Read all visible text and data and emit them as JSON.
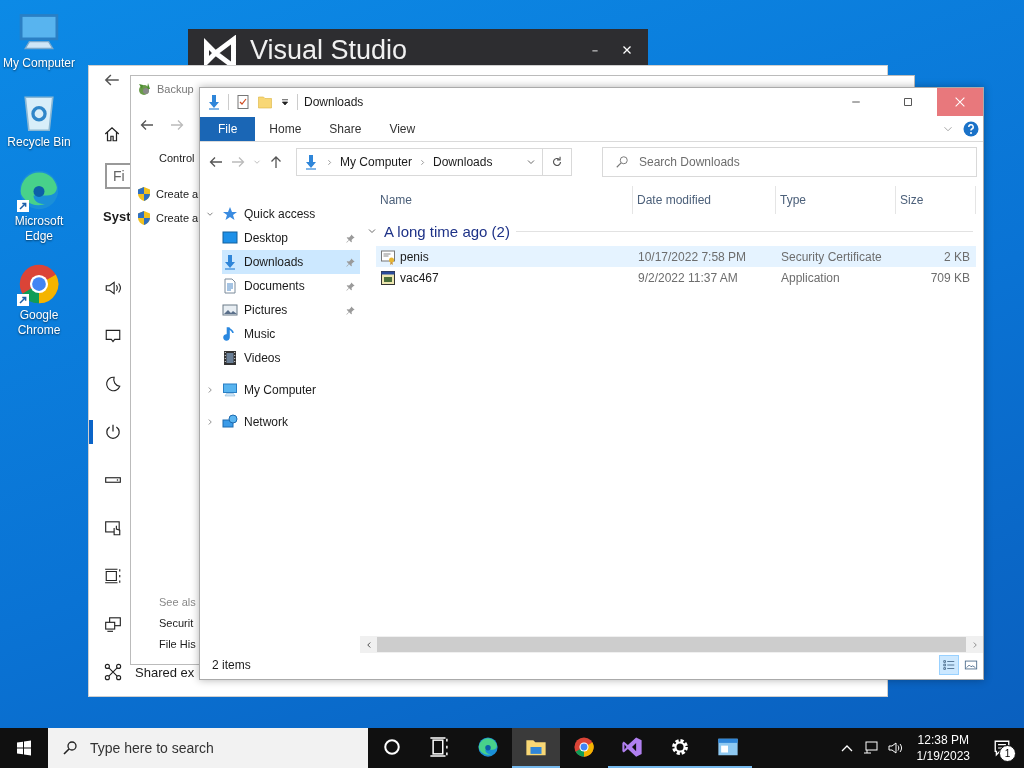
{
  "desktop_icons": [
    {
      "kind": "computer",
      "label": "My Computer",
      "shortcut": false
    },
    {
      "kind": "recycle",
      "label": "Recycle Bin",
      "shortcut": false
    },
    {
      "kind": "edge",
      "label": "Microsoft Edge",
      "shortcut": true
    },
    {
      "kind": "chrome",
      "label": "Google Chrome",
      "shortcut": true
    }
  ],
  "splash_window": {
    "title": "Visual Studio"
  },
  "settings_window": {
    "search_placeholder": "Fi",
    "heading": "Syst",
    "nav": [
      {
        "kind": "sound",
        "selected": false
      },
      {
        "kind": "notifications",
        "selected": false
      },
      {
        "kind": "focus",
        "selected": false
      },
      {
        "kind": "power",
        "selected": true
      },
      {
        "kind": "storage",
        "selected": false
      },
      {
        "kind": "tablet",
        "selected": false
      },
      {
        "kind": "multitasking",
        "selected": false
      },
      {
        "kind": "projecting",
        "selected": false
      },
      {
        "kind": "shared",
        "selected": false,
        "label": "Shared ex"
      }
    ]
  },
  "control_panel_window": {
    "title": "Backup",
    "breadcrumb": "Control",
    "tasks": [
      "Create a",
      "Create a"
    ],
    "see_also_heading": "See als",
    "see_also": [
      "Securit",
      "File His"
    ]
  },
  "explorer_window": {
    "title": "Downloads",
    "ribbon_tabs": [
      {
        "label": "File",
        "selected": true
      },
      {
        "label": "Home",
        "selected": false
      },
      {
        "label": "Share",
        "selected": false
      },
      {
        "label": "View",
        "selected": false
      }
    ],
    "address": [
      "My Computer",
      "Downloads"
    ],
    "search_placeholder": "Search Downloads",
    "nav_tree": [
      {
        "label": "Quick access",
        "kind": "star",
        "expanded": true,
        "selected": false,
        "children": [
          {
            "label": "Desktop",
            "kind": "desktop",
            "pinned": true,
            "selected": false
          },
          {
            "label": "Downloads",
            "kind": "downloads",
            "pinned": true,
            "selected": true
          },
          {
            "label": "Documents",
            "kind": "documents",
            "pinned": true,
            "selected": false
          },
          {
            "label": "Pictures",
            "kind": "pictures",
            "pinned": true,
            "selected": false
          },
          {
            "label": "Music",
            "kind": "music",
            "pinned": false,
            "selected": false
          },
          {
            "label": "Videos",
            "kind": "videos",
            "pinned": false,
            "selected": false
          }
        ]
      },
      {
        "label": "My Computer",
        "kind": "computer",
        "expanded": false,
        "selected": false
      },
      {
        "label": "Network",
        "kind": "network",
        "expanded": false,
        "selected": false
      }
    ],
    "columns": [
      "Name",
      "Date modified",
      "Type",
      "Size"
    ],
    "group": {
      "label": "A long time ago (2)",
      "expanded": true,
      "files": [
        {
          "name": "penis",
          "kind": "certificate",
          "date": "10/17/2022 7:58 PM",
          "type": "Security Certificate",
          "size": "2 KB",
          "selected": true
        },
        {
          "name": "vac467",
          "kind": "application",
          "date": "9/2/2022 11:37 AM",
          "type": "Application",
          "size": "709 KB",
          "selected": false
        }
      ]
    },
    "status": "2 items",
    "views": [
      {
        "kind": "details",
        "selected": true
      },
      {
        "kind": "large-icons",
        "selected": false
      }
    ]
  },
  "taskbar": {
    "search_placeholder": "Type here to search",
    "apps": [
      {
        "kind": "cortana",
        "running": false,
        "active": false
      },
      {
        "kind": "taskview",
        "running": false,
        "active": false
      },
      {
        "kind": "edge",
        "running": false,
        "active": false
      },
      {
        "kind": "explorer",
        "running": true,
        "active": true
      },
      {
        "kind": "chrome",
        "running": false,
        "active": false
      },
      {
        "kind": "vs",
        "running": true,
        "active": false
      },
      {
        "kind": "settings",
        "running": true,
        "active": false
      },
      {
        "kind": "app",
        "running": true,
        "active": false
      }
    ],
    "time": "12:38 PM",
    "date": "1/19/2023",
    "notification_count": "1"
  }
}
